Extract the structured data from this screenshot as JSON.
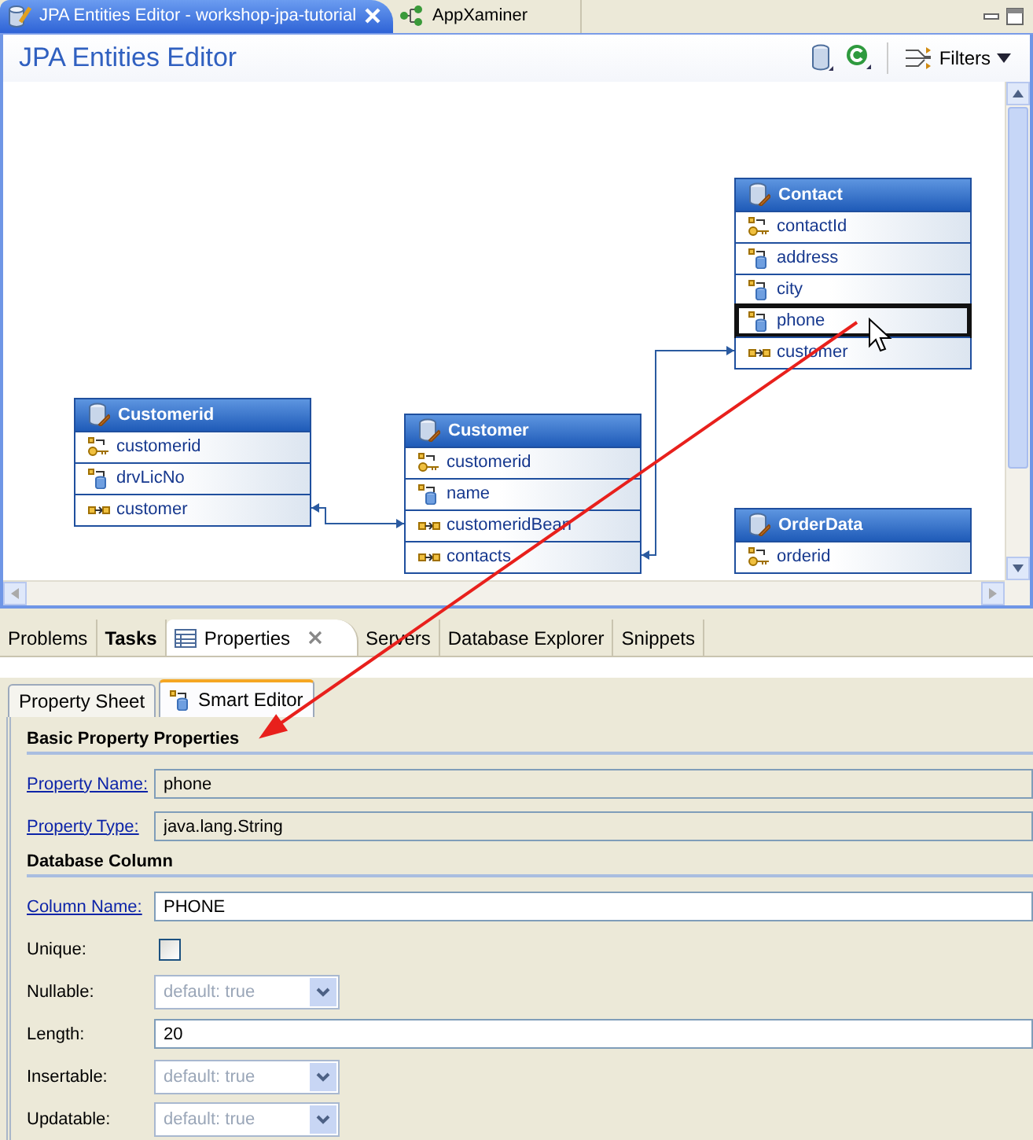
{
  "editor_tabs": [
    {
      "label": "JPA Entities Editor - workshop-jpa-tutorial",
      "selected": true,
      "kind": "jpa"
    },
    {
      "label": "AppXaminer",
      "selected": false,
      "kind": "graph"
    }
  ],
  "editor": {
    "title": "JPA Entities Editor",
    "filters_label": "Filters"
  },
  "entities": [
    {
      "name": "Contact",
      "fields": [
        {
          "name": "contactId",
          "kind": "id",
          "selected": false
        },
        {
          "name": "address",
          "kind": "basic",
          "selected": false
        },
        {
          "name": "city",
          "kind": "basic",
          "selected": false
        },
        {
          "name": "phone",
          "kind": "basic",
          "selected": true
        },
        {
          "name": "customer",
          "kind": "relation",
          "selected": false
        }
      ]
    },
    {
      "name": "Customerid",
      "fields": [
        {
          "name": "customerid",
          "kind": "id",
          "selected": false
        },
        {
          "name": "drvLicNo",
          "kind": "basic",
          "selected": false
        },
        {
          "name": "customer",
          "kind": "relation",
          "selected": false
        }
      ]
    },
    {
      "name": "Customer",
      "fields": [
        {
          "name": "customerid",
          "kind": "id",
          "selected": false
        },
        {
          "name": "name",
          "kind": "basic",
          "selected": false
        },
        {
          "name": "customeridBean",
          "kind": "relation",
          "selected": false
        },
        {
          "name": "contacts",
          "kind": "relation",
          "selected": false
        }
      ]
    },
    {
      "name": "OrderData",
      "fields": [
        {
          "name": "orderid",
          "kind": "id",
          "selected": false
        }
      ]
    }
  ],
  "view_tabs": [
    {
      "label": "Problems",
      "selected": false
    },
    {
      "label": "Tasks",
      "selected": false
    },
    {
      "label": "Properties",
      "selected": true
    },
    {
      "label": "Servers",
      "selected": false
    },
    {
      "label": "Database Explorer",
      "selected": false
    },
    {
      "label": "Snippets",
      "selected": false
    }
  ],
  "property_tabs": [
    {
      "label": "Property Sheet",
      "selected": false
    },
    {
      "label": "Smart Editor",
      "selected": true
    }
  ],
  "sections": [
    {
      "title": "Basic Property Properties",
      "fields": [
        {
          "label": "Property Name:",
          "kind": "readonly",
          "link": true,
          "value": "phone"
        },
        {
          "label": "Property Type:",
          "kind": "readonly",
          "link": true,
          "value": "java.lang.String"
        }
      ]
    },
    {
      "title": "Database Column",
      "fields": [
        {
          "label": "Column Name:",
          "kind": "text",
          "link": true,
          "value": "PHONE"
        },
        {
          "label": "Unique:",
          "kind": "checkbox",
          "link": false,
          "checked": false
        },
        {
          "label": "Nullable:",
          "kind": "combo",
          "link": false,
          "value": "default: true"
        },
        {
          "label": "Length:",
          "kind": "text",
          "link": false,
          "value": "20"
        },
        {
          "label": "Insertable:",
          "kind": "combo",
          "link": false,
          "value": "default: true"
        },
        {
          "label": "Updatable:",
          "kind": "combo",
          "link": false,
          "value": "default: true"
        }
      ]
    }
  ]
}
